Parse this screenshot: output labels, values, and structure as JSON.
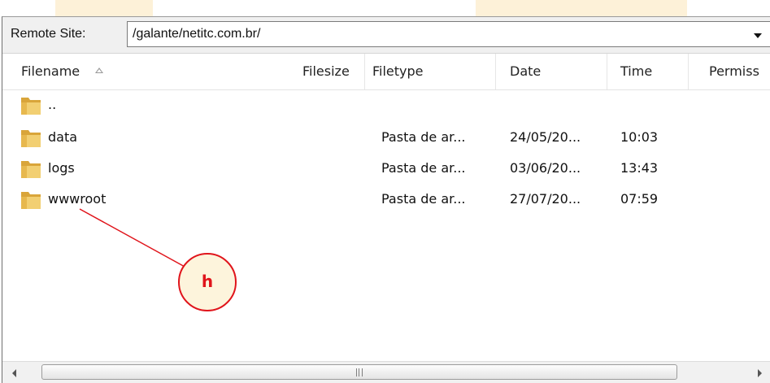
{
  "remote_site": {
    "label": "Remote Site:",
    "path": "/galante/netitc.com.br/"
  },
  "columns": [
    {
      "key": "filename",
      "label": "Filename"
    },
    {
      "key": "filesize",
      "label": "Filesize"
    },
    {
      "key": "filetype",
      "label": "Filetype"
    },
    {
      "key": "date",
      "label": "Date"
    },
    {
      "key": "time",
      "label": "Time"
    },
    {
      "key": "permissions",
      "label": "Permiss"
    }
  ],
  "sort": {
    "column": "filename",
    "direction": "ascending",
    "icon": "sort-ascending-icon"
  },
  "rows": [
    {
      "name": "..",
      "filesize": "",
      "filetype": "",
      "date": "",
      "time": "",
      "icon": "folder-icon"
    },
    {
      "name": "data",
      "filesize": "",
      "filetype": "Pasta de ar...",
      "date": "24/05/20...",
      "time": "10:03",
      "icon": "folder-icon"
    },
    {
      "name": "logs",
      "filesize": "",
      "filetype": "Pasta de ar...",
      "date": "03/06/20...",
      "time": "13:43",
      "icon": "folder-icon"
    },
    {
      "name": "wwwroot",
      "filesize": "",
      "filetype": "Pasta de ar...",
      "date": "27/07/20...",
      "time": "07:59",
      "icon": "folder-icon"
    }
  ],
  "annotation": {
    "label": "h",
    "color": "#e0141b",
    "fill": "#fdf4dc"
  },
  "colors": {
    "folder": "#e8b94a",
    "accent_red": "#e0141b"
  }
}
